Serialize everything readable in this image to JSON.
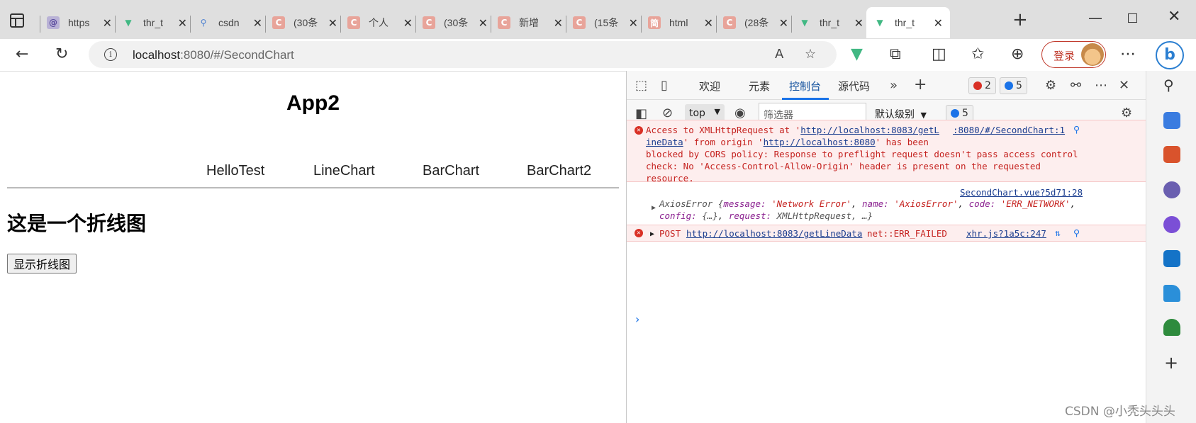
{
  "browser": {
    "tabs": [
      {
        "title": "https",
        "icon": "swirl-icon"
      },
      {
        "title": "thr_t",
        "icon": "vue-icon"
      },
      {
        "title": "csdn",
        "icon": "search-icon"
      },
      {
        "title": "(30条",
        "icon": "csdn-icon"
      },
      {
        "title": "个人",
        "icon": "csdn-icon"
      },
      {
        "title": "(30条",
        "icon": "csdn-icon"
      },
      {
        "title": "新增",
        "icon": "csdn-icon"
      },
      {
        "title": "(15条",
        "icon": "csdn-icon"
      },
      {
        "title": "html",
        "icon": "jianshu-icon"
      },
      {
        "title": "(28条",
        "icon": "csdn-icon"
      },
      {
        "title": "thr_t",
        "icon": "vue-icon"
      },
      {
        "title": "thr_t",
        "icon": "vue-icon",
        "active": true
      }
    ],
    "address": {
      "host": "localhost",
      "rest": ":8080/#/SecondChart"
    },
    "login_label": "登录",
    "favicon_letter_c": "C",
    "favicon_letter_jian": "简"
  },
  "page": {
    "app_title": "App2",
    "nav": [
      "HelloTest",
      "LineChart",
      "BarChart",
      "BarChart2"
    ],
    "heading": "这是一个折线图",
    "button": "显示折线图"
  },
  "devtools": {
    "tabs": [
      "欢迎",
      "元素",
      "控制台",
      "源代码"
    ],
    "active_tab": "控制台",
    "error_count": "2",
    "info_count": "5",
    "context": "top",
    "filter_placeholder": "筛选器",
    "level": "默认级别",
    "level_count": "5",
    "messages": {
      "cors": {
        "source": ":8080/#/SecondChart:1",
        "p1": "Access to XMLHttpRequest at '",
        "url1a": "http://localhost:8083/getL",
        "url1b": "ineData",
        "p2": "' from origin '",
        "url2": "http://localhost:8080",
        "p3": "' has been",
        "line3": "blocked by CORS policy: Response to preflight request doesn't pass access control",
        "line4": "check: No 'Access-Control-Allow-Origin' header is present on the requested",
        "line5": "resource."
      },
      "axios": {
        "source": "SecondChart.vue?5d71:28",
        "prefix": "AxiosError {",
        "k1": "message:",
        "v1": "'Network Error'",
        "k2": "name:",
        "v2": "'AxiosError'",
        "k3": "code:",
        "v3": "'ERR_NETWORK'",
        "k4": "config:",
        "v4": "{…}",
        "k5": "request:",
        "v5": "XMLHttpRequest, …}"
      },
      "post": {
        "method": "POST",
        "url": "http://localhost:8083/getLineData",
        "status": "net::ERR_FAILED",
        "source": "xhr.js?1a5c:247"
      }
    }
  },
  "watermark": "CSDN @小秃头头头"
}
